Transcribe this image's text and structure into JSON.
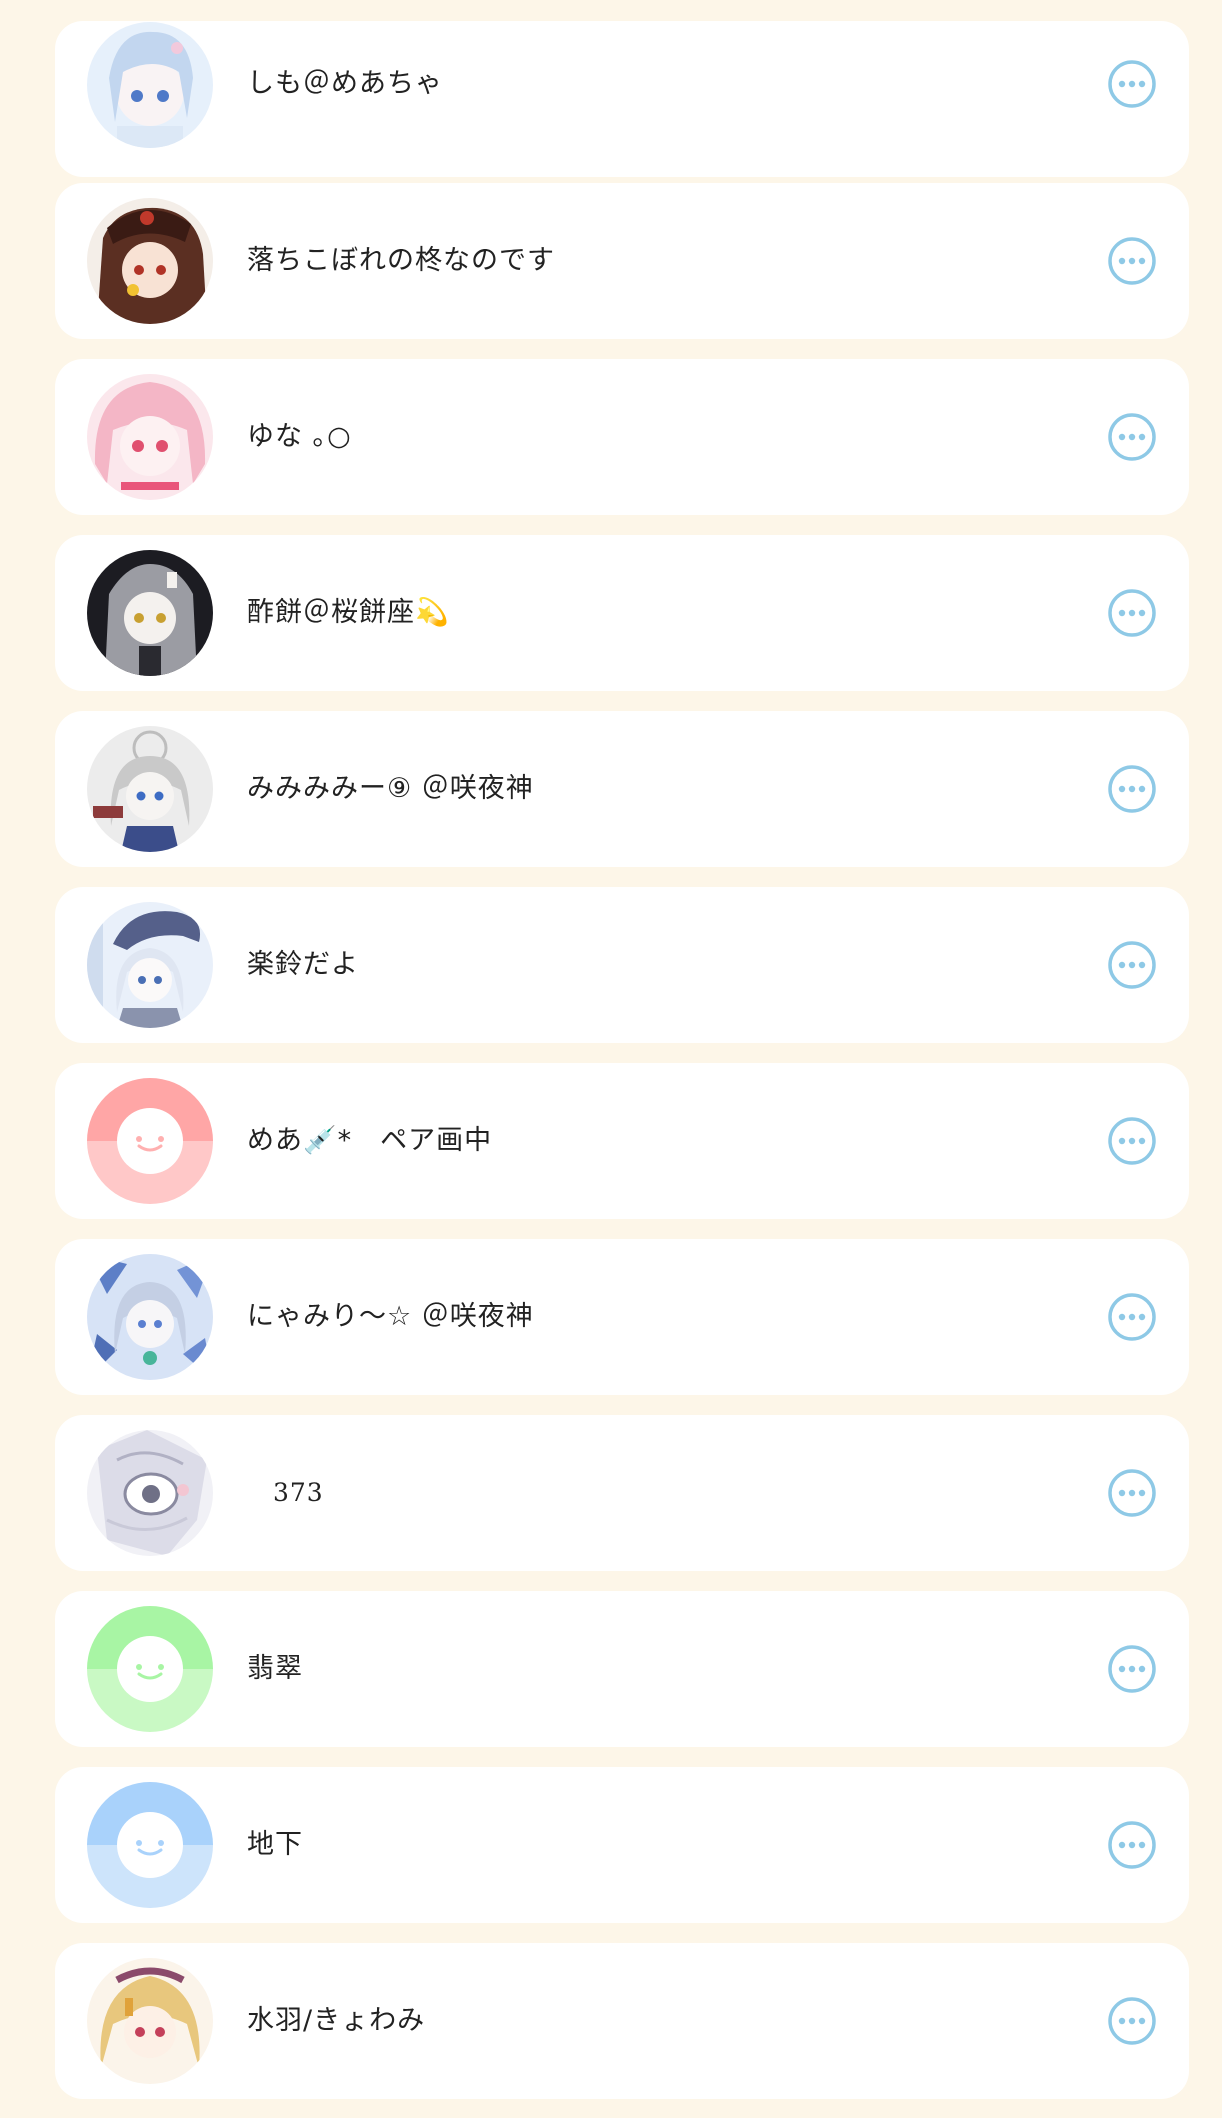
{
  "accent_color": "#8ec9e6",
  "contacts": [
    {
      "name": "しも＠めあちゃ",
      "avatar": "anime-portrait"
    },
    {
      "name": "落ちこぼれの柊なのです",
      "avatar": "anime-portrait"
    },
    {
      "name": "ゆな ｡○",
      "avatar": "anime-portrait"
    },
    {
      "name": "酢餅＠桜餅座💫",
      "avatar": "anime-portrait"
    },
    {
      "name": "みみみみー⑨ ＠咲夜神",
      "avatar": "anime-portrait"
    },
    {
      "name": "楽鈴だよ",
      "avatar": "anime-portrait"
    },
    {
      "name": "めあ💉*　ペア画中",
      "avatar": "default-face-pink"
    },
    {
      "name": "にゃみり〜☆ ＠咲夜神",
      "avatar": "anime-portrait"
    },
    {
      "name": "373",
      "avatar": "anime-portrait"
    },
    {
      "name": "翡翠",
      "avatar": "default-face-green"
    },
    {
      "name": "地下",
      "avatar": "default-face-blue"
    },
    {
      "name": "水羽/きょわみ",
      "avatar": "anime-portrait"
    }
  ],
  "more_icon": "more-horizontal-circle-icon"
}
